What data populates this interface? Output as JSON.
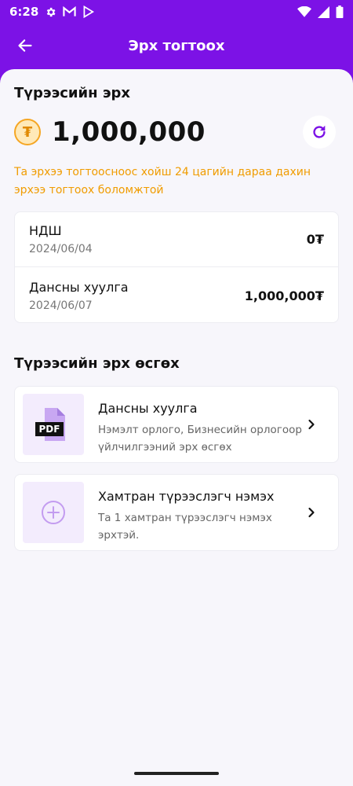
{
  "status_bar": {
    "time": "6:28"
  },
  "header": {
    "title": "Эрх тогтоох"
  },
  "limit": {
    "section_title": "Түрээсийн эрх",
    "currency_symbol": "₮",
    "amount": "1,000,000",
    "notice": "Та эрхээ тогтоосноос хойш 24 цагийн дараа дахин эрхээ тогтоох боломжтой"
  },
  "history": [
    {
      "label": "НДШ",
      "date": "2024/06/04",
      "amount": "0₮"
    },
    {
      "label": "Дансны хуулга",
      "date": "2024/06/07",
      "amount": "1,000,000₮"
    }
  ],
  "increase": {
    "section_title": "Түрээсийн эрх өсгөх",
    "options": [
      {
        "title": "Дансны хуулга",
        "description": "Нэмэлт орлого, Бизнесийн орлогоор үйлчилгээний эрх өсгөх",
        "badge": "PDF",
        "icon": "pdf-file-icon"
      },
      {
        "title": "Хамтран түрээслэгч нэмэх",
        "description": "Та 1 хамтран түрээслэгч нэмэх эрхтэй.",
        "icon": "add-circle-icon"
      }
    ]
  },
  "colors": {
    "primary": "#7c12e6",
    "accent_orange": "#f09c00",
    "background": "#f7f6fb"
  }
}
